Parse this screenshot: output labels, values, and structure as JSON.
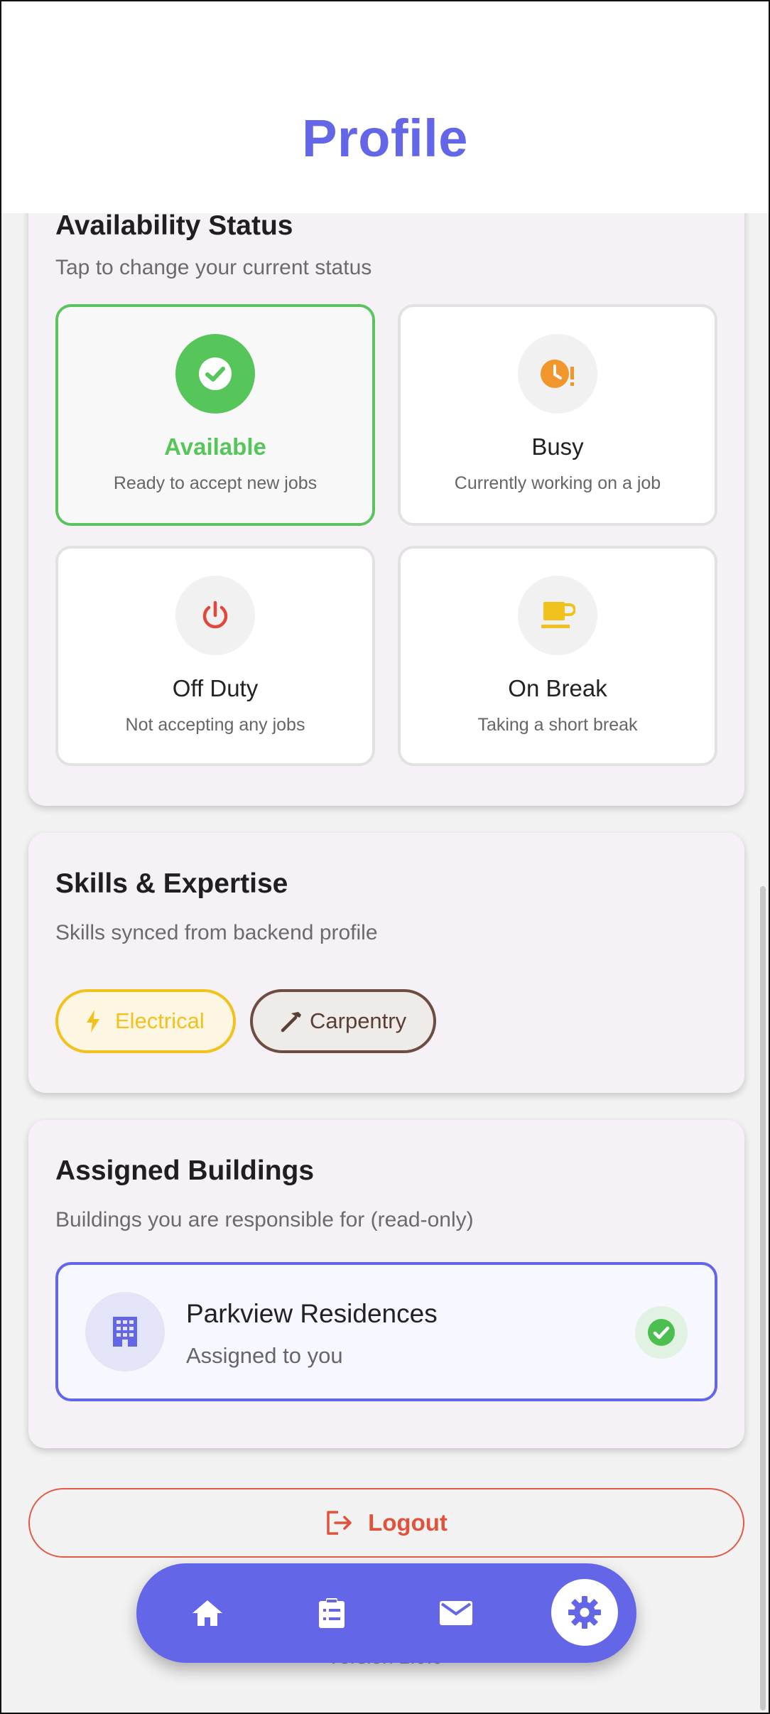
{
  "header": {
    "title": "Profile"
  },
  "availability": {
    "title": "Availability Status",
    "subtitle": "Tap to change your current status",
    "options": [
      {
        "label": "Available",
        "description": "Ready to accept new jobs",
        "selected": true,
        "icon": "check-circle-icon",
        "color": "#57c65a"
      },
      {
        "label": "Busy",
        "description": "Currently working on a job",
        "selected": false,
        "icon": "clock-alert-icon",
        "color": "#f0962c"
      },
      {
        "label": "Off Duty",
        "description": "Not accepting any jobs",
        "selected": false,
        "icon": "power-icon",
        "color": "#e0483c"
      },
      {
        "label": "On Break",
        "description": "Taking a short break",
        "selected": false,
        "icon": "coffee-icon",
        "color": "#f2c21c"
      }
    ]
  },
  "skills": {
    "title": "Skills & Expertise",
    "subtitle": "Skills synced from backend profile",
    "items": [
      {
        "label": "Electrical",
        "icon": "bolt-icon",
        "color": "#f2c21c"
      },
      {
        "label": "Carpentry",
        "icon": "hammer-icon",
        "color": "#6d4c41"
      }
    ]
  },
  "buildings": {
    "title": "Assigned Buildings",
    "subtitle": "Buildings you are responsible for (read-only)",
    "items": [
      {
        "name": "Parkview Residences",
        "status": "Assigned to you"
      }
    ]
  },
  "logout": {
    "label": "Logout"
  },
  "footer": {
    "version": "Version 1.0.0"
  },
  "nav": {
    "items": [
      {
        "icon": "home-icon",
        "active": false
      },
      {
        "icon": "clipboard-list-icon",
        "active": false
      },
      {
        "icon": "mail-icon",
        "active": false
      },
      {
        "icon": "gear-icon",
        "active": true
      }
    ]
  },
  "colors": {
    "accent": "#6366e6",
    "success": "#57c65a",
    "danger": "#e0523c"
  }
}
